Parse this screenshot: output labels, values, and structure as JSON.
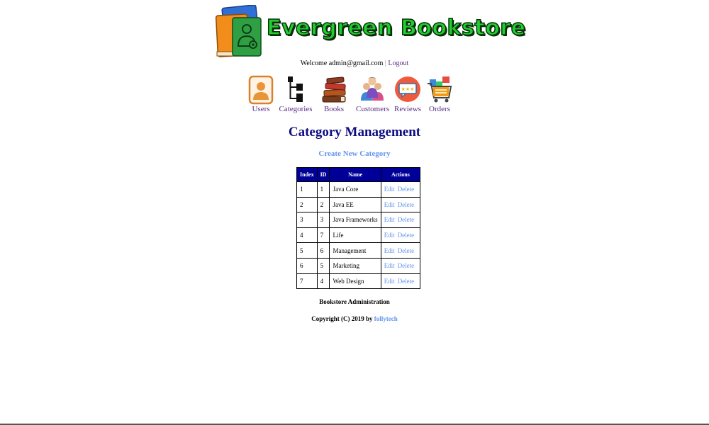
{
  "header": {
    "logo_text": "Evergreen Bookstore",
    "welcome_prefix": "Welcome admin@gmail.com",
    "separator": "|",
    "logout_label": "Logout"
  },
  "menu": {
    "items": [
      {
        "label": "Users",
        "icon": "users-icon"
      },
      {
        "label": "Categories",
        "icon": "categories-icon"
      },
      {
        "label": "Books",
        "icon": "books-icon"
      },
      {
        "label": "Customers",
        "icon": "customers-icon"
      },
      {
        "label": "Reviews",
        "icon": "reviews-icon"
      },
      {
        "label": "Orders",
        "icon": "orders-icon"
      }
    ]
  },
  "main": {
    "title": "Category Management",
    "create_label": "Create New Category",
    "table": {
      "headers": [
        "Index",
        "ID",
        "Name",
        "Actions"
      ],
      "edit_label": "Edit",
      "delete_label": "Delete",
      "rows": [
        {
          "index": "1",
          "id": "1",
          "name": "Java Core"
        },
        {
          "index": "2",
          "id": "2",
          "name": "Java EE"
        },
        {
          "index": "3",
          "id": "3",
          "name": "Java Frameworks"
        },
        {
          "index": "4",
          "id": "7",
          "name": "Life"
        },
        {
          "index": "5",
          "id": "6",
          "name": "Management"
        },
        {
          "index": "6",
          "id": "5",
          "name": "Marketing"
        },
        {
          "index": "7",
          "id": "4",
          "name": "Web Design"
        }
      ]
    }
  },
  "footer": {
    "title": "Bookstore Administration",
    "copyright_prefix": "Copyright (C) 2019 by",
    "author": "follytech"
  },
  "colors": {
    "title": "#0d0d80",
    "link": "#6495ed",
    "menu_label": "#5a2d82",
    "table_header": "#000099",
    "logo_green": "#1fcf2f"
  }
}
